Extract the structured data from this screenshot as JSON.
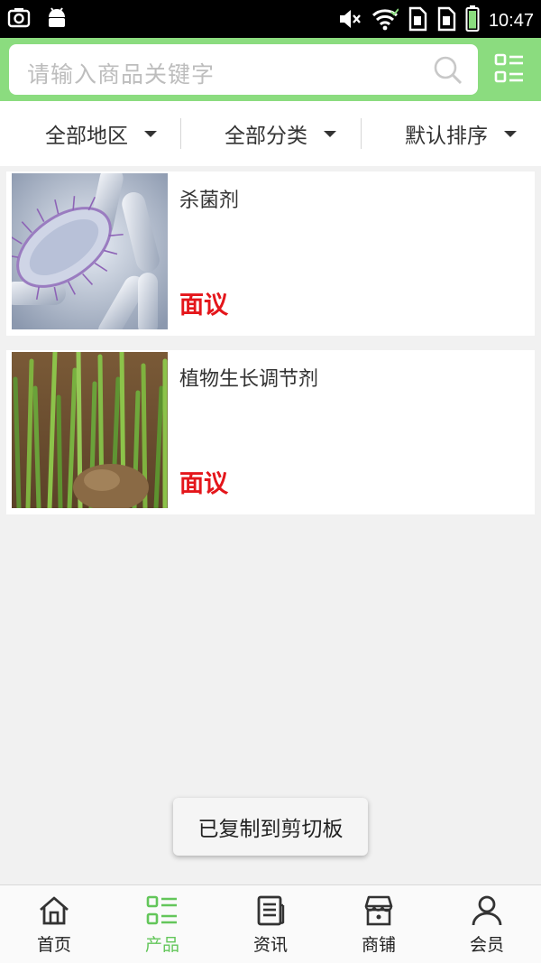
{
  "status_bar": {
    "time": "10:47"
  },
  "search": {
    "placeholder": "请输入商品关键字"
  },
  "filters": [
    {
      "label": "全部地区"
    },
    {
      "label": "全部分类"
    },
    {
      "label": "默认排序"
    }
  ],
  "products": [
    {
      "name": "杀菌剂",
      "price": "面议",
      "image_icon": "bacteria-image"
    },
    {
      "name": "植物生长调节剂",
      "price": "面议",
      "image_icon": "seedlings-image"
    }
  ],
  "toast": {
    "message": "已复制到剪切板"
  },
  "bottom_nav": [
    {
      "label": "首页",
      "icon": "home-icon",
      "active": false
    },
    {
      "label": "产品",
      "icon": "list-icon",
      "active": true
    },
    {
      "label": "资讯",
      "icon": "news-icon",
      "active": false
    },
    {
      "label": "商铺",
      "icon": "shop-icon",
      "active": false
    },
    {
      "label": "会员",
      "icon": "user-icon",
      "active": false
    }
  ],
  "colors": {
    "header_green": "#8bdc7f",
    "accent_green": "#63c65a",
    "price_red": "#e4161b"
  }
}
